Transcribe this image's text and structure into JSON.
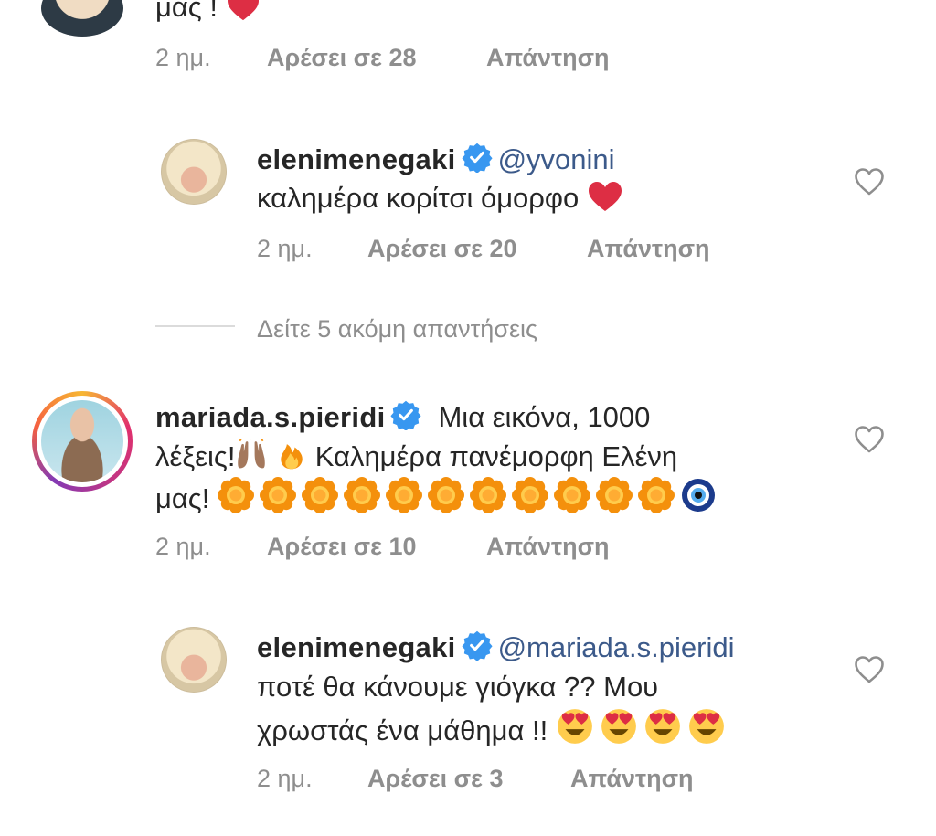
{
  "comments": [
    {
      "text_tail": "μας !",
      "time": "2 ημ.",
      "likes": "Αρέσει σε 28",
      "reply": "Απάντηση"
    },
    {
      "username": "elenimenegaki",
      "mention": "@yvonini",
      "text": "καλημέρα κορίτσι όμορφο",
      "time": "2 ημ.",
      "likes": "Αρέσει σε 20",
      "reply": "Απάντηση"
    },
    {
      "username": "mariada.s.pieridi",
      "text_line1": "Μια εικόνα, 1000",
      "text_line2_a": "λέξεις!",
      "text_line2_b": "Καλημέρα πανέμορφη Ελένη",
      "text_line3": "μας!",
      "time": "2 ημ.",
      "likes": "Αρέσει σε 10",
      "reply": "Απάντηση"
    },
    {
      "username": "elenimenegaki",
      "mention": "@mariada.s.pieridi",
      "text_line1": "ποτέ θα κάνουμε γιόγκα ?? Μου",
      "text_line2": "χρωστάς ένα μάθημα !!",
      "time": "2 ημ.",
      "likes": "Αρέσει σε 3",
      "reply": "Απάντηση"
    }
  ],
  "view_more": "Δείτε 5 ακόμη απαντήσεις",
  "icons": {
    "heart": "heart-outline-icon",
    "verified": "verified-badge-icon",
    "red_heart": "red-heart-emoji",
    "hands": "raising-hands-emoji",
    "fire": "fire-emoji",
    "flower": "blossom-emoji",
    "nazar": "nazar-amulet-emoji",
    "heart_eyes": "heart-eyes-emoji"
  },
  "colors": {
    "verified": "#3897f0",
    "mention": "#3c5a8a",
    "meta": "#8e8e8e",
    "red_heart": "#dd2e44"
  }
}
